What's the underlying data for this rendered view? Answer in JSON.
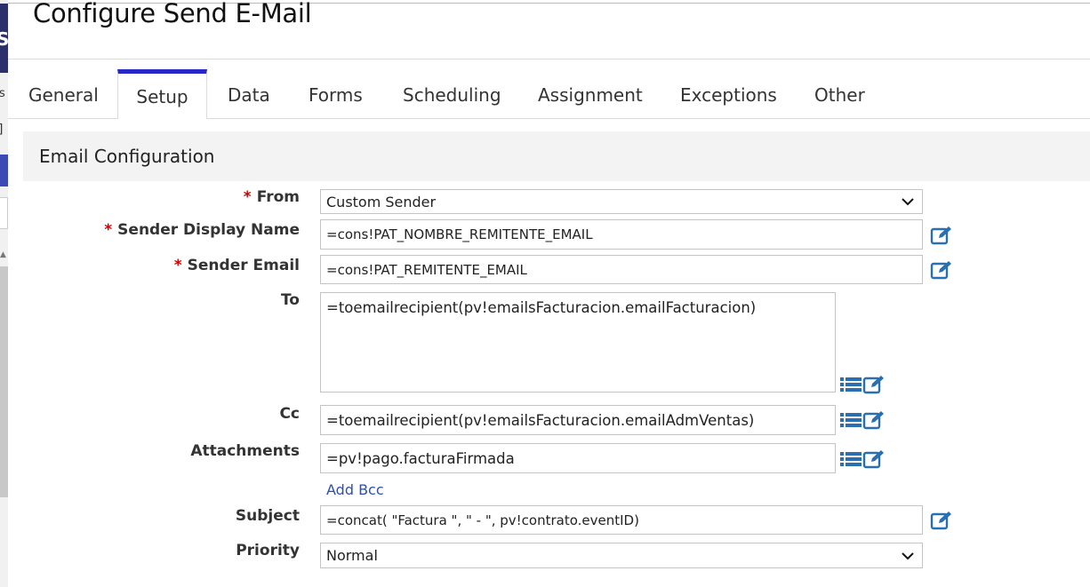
{
  "underlying_window": {
    "letter_s": "S",
    "letter_s2": "s",
    "bracket": "]"
  },
  "page": {
    "title": "Configure Send E-Mail"
  },
  "tabs": [
    {
      "label": "General"
    },
    {
      "label": "Setup"
    },
    {
      "label": "Data"
    },
    {
      "label": "Forms"
    },
    {
      "label": "Scheduling"
    },
    {
      "label": "Assignment"
    },
    {
      "label": "Exceptions"
    },
    {
      "label": "Other"
    }
  ],
  "active_tab": "Setup",
  "section": {
    "title": "Email Configuration"
  },
  "form": {
    "required_mark": "*",
    "from": {
      "label": "From",
      "value": "Custom Sender",
      "required": true
    },
    "sender_display_name": {
      "label": "Sender Display Name",
      "value": "=cons!PAT_NOMBRE_REMITENTE_EMAIL",
      "required": true
    },
    "sender_email": {
      "label": "Sender Email",
      "value": "=cons!PAT_REMITENTE_EMAIL",
      "required": true
    },
    "to": {
      "label": "To",
      "value": "=toemailrecipient(pv!emailsFacturacion.emailFacturacion)"
    },
    "cc": {
      "label": "Cc",
      "value": "=toemailrecipient(pv!emailsFacturacion.emailAdmVentas)"
    },
    "attachments": {
      "label": "Attachments",
      "value": "=pv!pago.facturaFirmada"
    },
    "add_bcc_label": "Add Bcc",
    "subject": {
      "label": "Subject",
      "value": "=concat(  \"Factura \",  \" - \",  pv!contrato.eventID)"
    },
    "priority": {
      "label": "Priority",
      "value": "Normal"
    }
  },
  "icons": {
    "edit": "edit-expression-icon",
    "list": "list-icon",
    "dropdown": "chevron-down-icon"
  },
  "colors": {
    "accent": "#2828c8",
    "required": "#cc0000",
    "icon_blue": "#2a6fb0",
    "link": "#2b4fb3",
    "section_bg": "#f3f3f3"
  }
}
